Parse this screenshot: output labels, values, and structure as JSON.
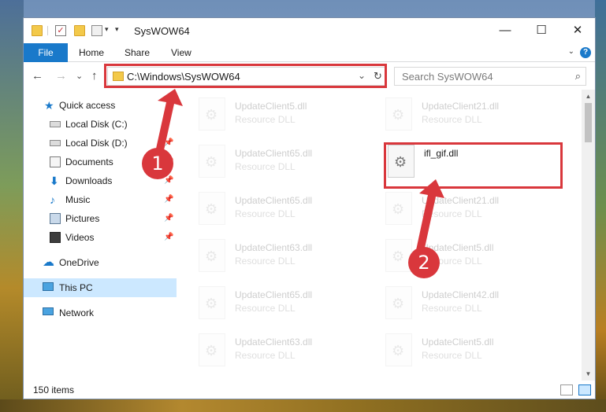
{
  "window": {
    "title": "SysWOW64",
    "controls": {
      "minimize": "—",
      "maximize": "☐",
      "close": "✕"
    }
  },
  "ribbon": {
    "file": "File",
    "tabs": [
      "Home",
      "Share",
      "View"
    ],
    "help": "?"
  },
  "address": {
    "path": "C:\\Windows\\SysWOW64",
    "chevron": "⌄",
    "refresh": "↻"
  },
  "search": {
    "placeholder": "Search SysWOW64",
    "icon": "⌕"
  },
  "nav_buttons": {
    "back": "←",
    "forward": "→",
    "recent": "⌄",
    "up": "↑"
  },
  "nav": {
    "items": [
      {
        "label": "Quick access",
        "icon": "star-icon"
      },
      {
        "label": "Local Disk (C:)",
        "icon": "drive-icon"
      },
      {
        "label": "Local Disk (D:)",
        "icon": "drive-icon"
      },
      {
        "label": "Documents",
        "icon": "documents-icon"
      },
      {
        "label": "Downloads",
        "icon": "downloads-icon"
      },
      {
        "label": "Music",
        "icon": "music-icon"
      },
      {
        "label": "Pictures",
        "icon": "pictures-icon"
      },
      {
        "label": "Videos",
        "icon": "videos-icon"
      },
      {
        "label": "OneDrive",
        "icon": "onedrive-icon"
      },
      {
        "label": "This PC",
        "icon": "this-pc-icon"
      },
      {
        "label": "Network",
        "icon": "network-icon"
      }
    ],
    "pin": "📌"
  },
  "files": [
    {
      "name": "UpdateClient5.dll",
      "type": "Resource DLL"
    },
    {
      "name": "UpdateClient21.dll",
      "type": "Resource DLL"
    },
    {
      "name": "UpdateClient65.dll",
      "type": "Resource DLL"
    },
    {
      "name": "ifl_gif.dll",
      "type": ""
    },
    {
      "name": "UpdateClient65.dll",
      "type": "Resource DLL"
    },
    {
      "name": "UpdateClient21.dll",
      "type": "Resource DLL"
    },
    {
      "name": "UpdateClient63.dll",
      "type": "Resource DLL"
    },
    {
      "name": "UpdateClient5.dll",
      "type": "Resource DLL"
    },
    {
      "name": "UpdateClient65.dll",
      "type": "Resource DLL"
    },
    {
      "name": "UpdateClient42.dll",
      "type": "Resource DLL"
    },
    {
      "name": "UpdateClient63.dll",
      "type": "Resource DLL"
    },
    {
      "name": "UpdateClient5.dll",
      "type": "Resource DLL"
    }
  ],
  "status": {
    "count": "150 items"
  },
  "markers": {
    "one": "1",
    "two": "2"
  },
  "colors": {
    "accent": "#1979ca",
    "highlight": "#d9373c",
    "selected": "#cce8ff"
  }
}
